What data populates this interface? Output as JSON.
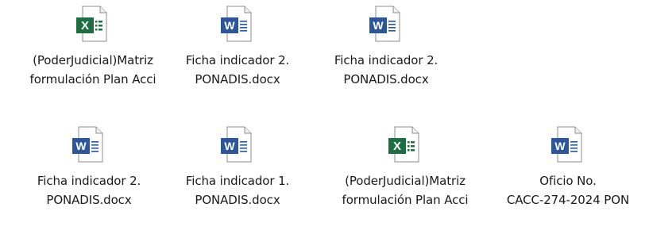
{
  "colors": {
    "excel_green": "#1D6F42",
    "word_blue": "#2B579A",
    "page_fill": "#ffffff",
    "page_stroke": "#8c8c8c"
  },
  "files": [
    {
      "type": "excel",
      "icon": "excel-file-icon",
      "name_line1": "(PoderJudicial)Matriz",
      "name_line2": "formulación Plan Acci"
    },
    {
      "type": "word",
      "icon": "word-file-icon",
      "name_line1": "Ficha indicador 2.",
      "name_line2": "PONADIS.docx"
    },
    {
      "type": "word",
      "icon": "word-file-icon",
      "name_line1": "Ficha indicador 2.",
      "name_line2": "PONADIS.docx"
    },
    {
      "type": "word",
      "icon": "word-file-icon",
      "name_line1": "Ficha indicador 2.",
      "name_line2": "PONADIS.docx"
    },
    {
      "type": "word",
      "icon": "word-file-icon",
      "name_line1": "Ficha indicador 1.",
      "name_line2": "PONADIS.docx"
    },
    {
      "type": "excel",
      "icon": "excel-file-icon",
      "name_line1": "(PoderJudicial)Matriz",
      "name_line2": "formulación Plan Acci"
    },
    {
      "type": "word",
      "icon": "word-file-icon",
      "name_line1": "Oficio No.",
      "name_line2": "CACC-274-2024 PON"
    }
  ]
}
